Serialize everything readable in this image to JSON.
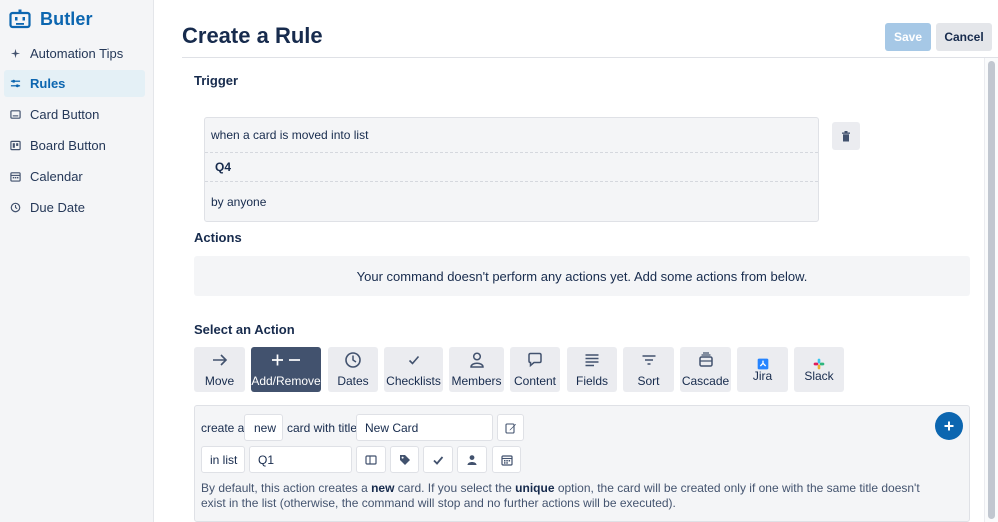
{
  "app": {
    "name": "Butler"
  },
  "sidebar": {
    "items": [
      {
        "label": "Automation Tips",
        "icon": "sparkle-icon"
      },
      {
        "label": "Rules",
        "icon": "sliders-icon",
        "active": true
      },
      {
        "label": "Card Button",
        "icon": "card-icon"
      },
      {
        "label": "Board Button",
        "icon": "board-icon"
      },
      {
        "label": "Calendar",
        "icon": "calendar-icon"
      },
      {
        "label": "Due Date",
        "icon": "clock-icon"
      }
    ]
  },
  "header": {
    "title": "Create a Rule",
    "save_label": "Save",
    "cancel_label": "Cancel"
  },
  "trigger": {
    "title": "Trigger",
    "line1": "when a card is moved into list",
    "line2": "Q4",
    "line3": "by anyone"
  },
  "actions": {
    "title": "Actions",
    "empty_message": "Your command doesn't perform any actions yet. Add some actions from below."
  },
  "select_action": {
    "title": "Select an Action",
    "tabs": [
      {
        "label": "Move",
        "icon": "arrow-right-icon"
      },
      {
        "label": "Add/Remove",
        "icon": "plus-minus-icon",
        "active": true
      },
      {
        "label": "Dates",
        "icon": "clock-icon"
      },
      {
        "label": "Checklists",
        "icon": "check-icon"
      },
      {
        "label": "Members",
        "icon": "person-icon"
      },
      {
        "label": "Content",
        "icon": "comment-icon"
      },
      {
        "label": "Fields",
        "icon": "lines-icon"
      },
      {
        "label": "Sort",
        "icon": "sort-icon"
      },
      {
        "label": "Cascade",
        "icon": "cascade-icon"
      },
      {
        "label": "Jira",
        "icon": "jira-icon"
      },
      {
        "label": "Slack",
        "icon": "slack-icon"
      }
    ]
  },
  "builder": {
    "create_a": "create a",
    "new_value": "new",
    "card_with_title": "card with title",
    "title_value": "New Card",
    "in_list": "in list",
    "list_value": "Q1",
    "help_part1": "By default, this action creates a ",
    "help_bold1": "new",
    "help_part2": " card. If you select the ",
    "help_bold2": "unique",
    "help_part3": " option, the card will be created only if one with the same title doesn't exist in the list (otherwise, the command will stop and no further actions will be executed)."
  },
  "colors": {
    "brand": "#0c66b0",
    "active_tab": "#42526e",
    "save_disabled": "#a6c8e6"
  }
}
